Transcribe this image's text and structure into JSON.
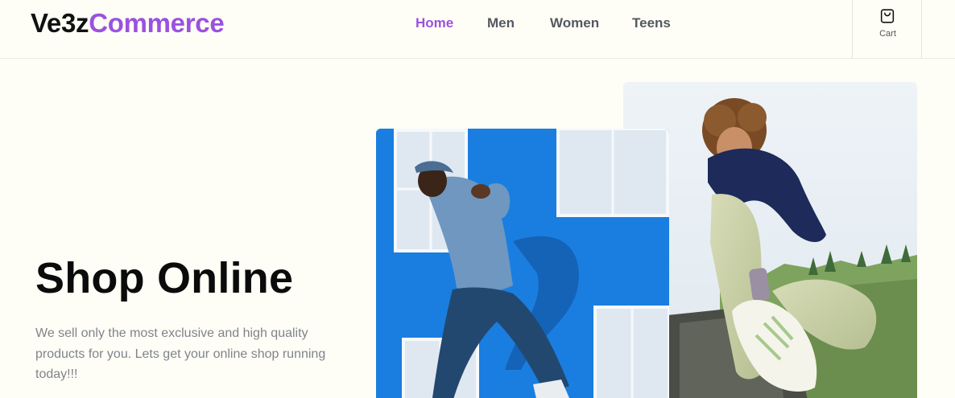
{
  "header": {
    "logo_part1": "Ve3z",
    "logo_part2": "Commerce",
    "nav": [
      {
        "label": "Home",
        "active": true
      },
      {
        "label": "Men",
        "active": false
      },
      {
        "label": "Women",
        "active": false
      },
      {
        "label": "Teens",
        "active": false
      }
    ],
    "cart_label": "Cart",
    "cart_icon": "shopping-bag-icon"
  },
  "hero": {
    "title": "Shop Online",
    "description": "We sell only the most exclusive and high quality products for you. Lets get your online shop running today!!!"
  },
  "images": {
    "front": "photo-man-jumping-blue-wall",
    "back": "photo-woman-sitting-on-rock"
  },
  "colors": {
    "brand_accent": "#9b51e0",
    "background": "#fefef6",
    "nav_text": "#55585f",
    "body_text": "#80838b"
  }
}
